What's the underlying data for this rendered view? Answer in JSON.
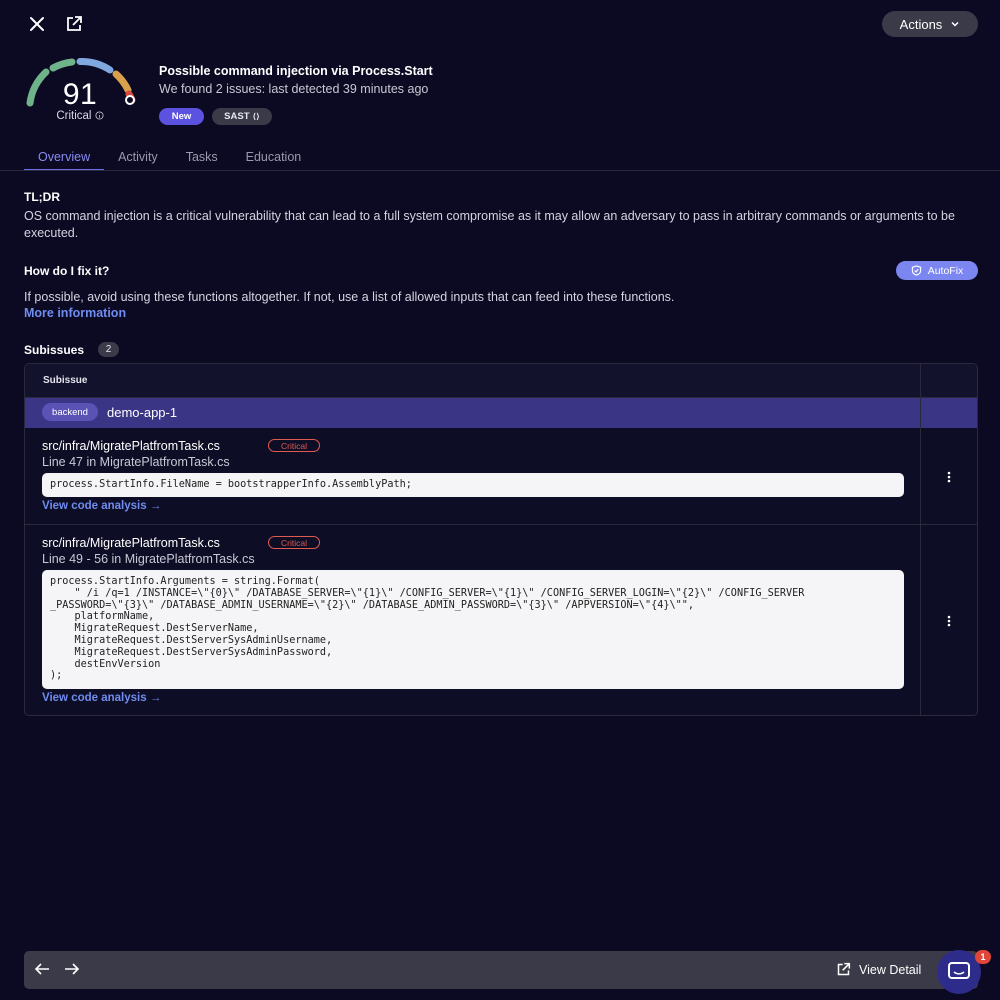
{
  "header": {
    "actions_label": "Actions"
  },
  "score": {
    "value": "91",
    "severity": "Critical"
  },
  "issue": {
    "title": "Possible command injection via Process.Start",
    "subtitle": "We found 2 issues: last detected 39 minutes ago",
    "badge_new": "New",
    "badge_sast": "SAST"
  },
  "tabs": [
    {
      "label": "Overview"
    },
    {
      "label": "Activity"
    },
    {
      "label": "Tasks"
    },
    {
      "label": "Education"
    }
  ],
  "tldr": {
    "heading": "TL;DR",
    "text": "OS command injection is a critical vulnerability that can lead to a full system compromise as it may allow an adversary to pass in arbitrary commands or arguments to be executed."
  },
  "fix": {
    "heading": "How do I fix it?",
    "autofix_label": "AutoFix",
    "text": "If possible, avoid using these functions altogether. If not, use a list of allowed inputs that can feed into these functions.",
    "more_info": "More information"
  },
  "subissues": {
    "heading": "Subissues",
    "count": "2",
    "column_header": "Subissue",
    "group": {
      "tag": "backend",
      "name": "demo-app-1"
    },
    "rows": [
      {
        "file": "src/infra/MigratePlatfromTask.cs",
        "severity": "Critical",
        "line_info": "Line 47 in MigratePlatfromTask.cs",
        "code": "process.StartInfo.FileName = bootstrapperInfo.AssemblyPath;",
        "link": "View code analysis →"
      },
      {
        "file": "src/infra/MigratePlatfromTask.cs",
        "severity": "Critical",
        "line_info": "Line 49 - 56 in MigratePlatfromTask.cs",
        "code": "process.StartInfo.Arguments = string.Format(\n    \" /i /q=1 /INSTANCE=\\\"{0}\\\" /DATABASE_SERVER=\\\"{1}\\\" /CONFIG_SERVER=\\\"{1}\\\" /CONFIG_SERVER_LOGIN=\\\"{2}\\\" /CONFIG_SERVER\n_PASSWORD=\\\"{3}\\\" /DATABASE_ADMIN_USERNAME=\\\"{2}\\\" /DATABASE_ADMIN_PASSWORD=\\\"{3}\\\" /APPVERSION=\\\"{4}\\\"\",\n    platformName,\n    MigrateRequest.DestServerName,\n    MigrateRequest.DestServerSysAdminUsername,\n    MigrateRequest.DestServerSysAdminPassword,\n    destEnvVersion\n);",
        "link": "View code analysis →"
      }
    ]
  },
  "footer": {
    "view_detail": "View Detail",
    "chat_badge_count": "1"
  },
  "colors": {
    "background": "#0b0a22",
    "accent": "#6b6ee8",
    "critical": "#e05a50",
    "group_row": "#3b3586"
  }
}
